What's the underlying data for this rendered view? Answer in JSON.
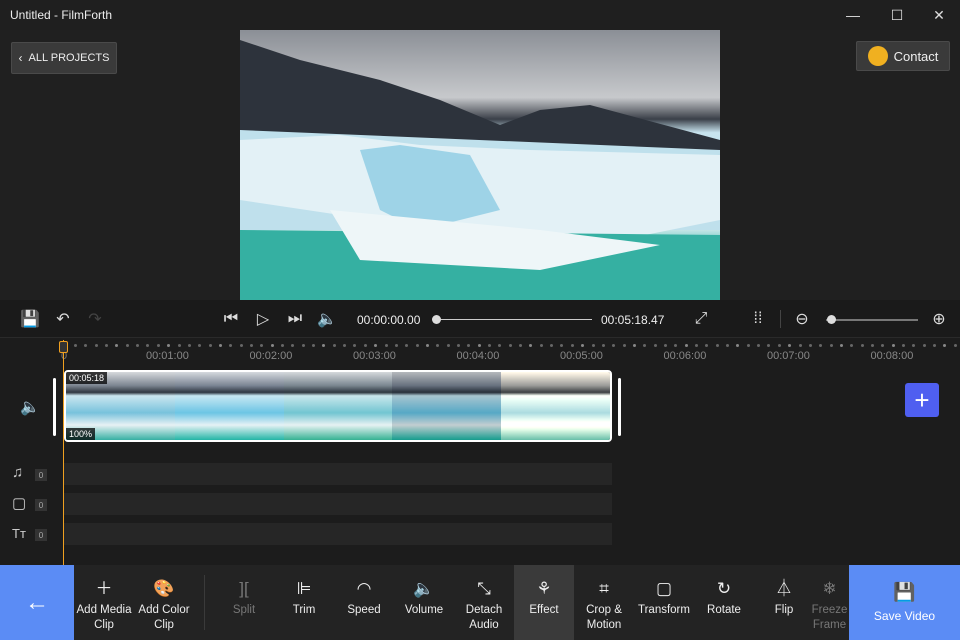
{
  "window": {
    "title": "Untitled - FilmForth",
    "minimize": "—",
    "maximize": "☐",
    "close": "✕"
  },
  "header": {
    "all_projects": "ALL PROJECTS",
    "contact": "Contact"
  },
  "player": {
    "current_time": "00:00:00.00",
    "total_time": "00:05:18.47",
    "progress": 0,
    "zoom_level": 0.05
  },
  "ruler": {
    "start": "0",
    "ticks": [
      "00:01:00",
      "00:02:00",
      "00:03:00",
      "00:04:00",
      "00:05:00",
      "00:06:00",
      "00:07:00",
      "00:08:00"
    ]
  },
  "clip": {
    "duration": "00:05:18",
    "volume": "100%"
  },
  "tracks": {
    "music_count": "0",
    "sticker_count": "0",
    "text_count": "0",
    "text_icon": "Tт"
  },
  "toolbar": {
    "back": "←",
    "tools": [
      {
        "label": "Add Media Clip",
        "icon": "＋",
        "name": "add-media-clip"
      },
      {
        "label": "Add Color Clip",
        "icon": "🎨",
        "name": "add-color-clip"
      },
      {
        "label": "Split",
        "icon": "][",
        "name": "split",
        "disabled": true
      },
      {
        "label": "Trim",
        "icon": "⊫",
        "name": "trim"
      },
      {
        "label": "Speed",
        "icon": "◠",
        "name": "speed"
      },
      {
        "label": "Volume",
        "icon": "🔈",
        "name": "volume"
      },
      {
        "label": "Detach Audio",
        "icon": "⤡",
        "name": "detach-audio"
      },
      {
        "label": "Effect",
        "icon": "⚘",
        "name": "effect",
        "active": true
      },
      {
        "label": "Crop & Motion",
        "icon": "⌗",
        "name": "crop-motion"
      },
      {
        "label": "Transform",
        "icon": "▢",
        "name": "transform"
      },
      {
        "label": "Rotate",
        "icon": "↻",
        "name": "rotate"
      },
      {
        "label": "Flip",
        "icon": "⏃",
        "name": "flip"
      },
      {
        "label": "Freeze Frame",
        "icon": "❄",
        "name": "freeze-frame",
        "disabled": true
      }
    ],
    "save": "Save Video"
  },
  "colors": {
    "accent": "#5b8cf5",
    "playhead": "#f0a020",
    "add": "#4f5ff0"
  }
}
